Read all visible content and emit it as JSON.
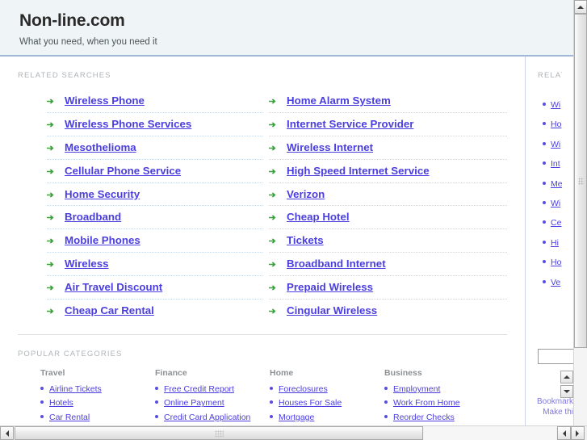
{
  "header": {
    "title": "Non-line.com",
    "tagline": "What you need, when you need it"
  },
  "main": {
    "related_label": "RELATED SEARCHES",
    "related_left": [
      "Wireless Phone",
      "Wireless Phone Services",
      "Mesothelioma",
      "Cellular Phone Service",
      "Home Security",
      "Broadband",
      "Mobile Phones",
      "Wireless",
      "Air Travel Discount",
      "Cheap Car Rental"
    ],
    "related_right": [
      "Home Alarm System",
      "Internet Service Provider",
      "Wireless Internet",
      "High Speed Internet Service",
      "Verizon",
      "Cheap Hotel",
      "Tickets",
      "Broadband Internet",
      "Prepaid Wireless",
      "Cingular Wireless"
    ],
    "popular_label": "POPULAR CATEGORIES",
    "categories": [
      {
        "heading": "Travel",
        "links": [
          "Airline Tickets",
          "Hotels",
          "Car Rental"
        ]
      },
      {
        "heading": "Finance",
        "links": [
          "Free Credit Report",
          "Online Payment",
          "Credit Card Application"
        ]
      },
      {
        "heading": "Home",
        "links": [
          "Foreclosures",
          "Houses For Sale",
          "Mortgage"
        ]
      },
      {
        "heading": "Business",
        "links": [
          "Employment",
          "Work From Home",
          "Reorder Checks"
        ]
      }
    ]
  },
  "sidebar": {
    "label": "RELATED",
    "links": [
      "Wi",
      "Ho",
      "Wi",
      "Int",
      "Me",
      "Wi",
      "Ce",
      "Hi",
      "Ho",
      "Ve"
    ],
    "search_value": "",
    "search_placeholder": "",
    "footer_links": [
      "Bookmark",
      "Make thi"
    ]
  },
  "colors": {
    "header_bg": "#eff5f7",
    "header_rule": "#9fb6d8",
    "link": "#4b3ede",
    "bullet_green": "#3aa33a",
    "bullet_dot": "#5a4ee0",
    "label_gray": "#b0b4b8",
    "dotted_rule": "#c8d8e8"
  },
  "scrollbars": {
    "vertical_up": "scroll-up-arrow",
    "horizontal_left": "scroll-left-arrow",
    "horizontal_right": "scroll-right-arrow"
  }
}
